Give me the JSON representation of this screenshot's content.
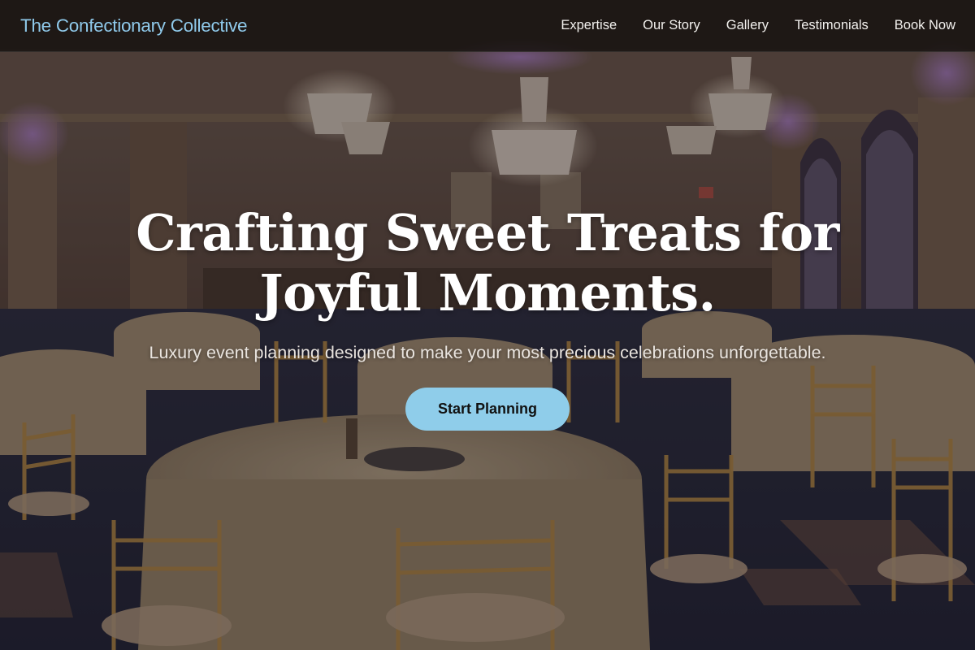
{
  "colors": {
    "brand": "#8fc9ea",
    "cta_background": "#8fcdea",
    "navbar_background": "#181412"
  },
  "navbar": {
    "brand": "The Confectionary Collective",
    "links": [
      "Expertise",
      "Our Story",
      "Gallery",
      "Testimonials",
      "Book Now"
    ]
  },
  "hero": {
    "title": "Crafting Sweet Treats for Joyful Moments.",
    "subtitle": "Luxury event planning designed to make your most precious celebrations unforgettable.",
    "cta_label": "Start Planning",
    "background_image": "ballroom with round tables, gold chiavari chairs and crystal chandeliers"
  }
}
